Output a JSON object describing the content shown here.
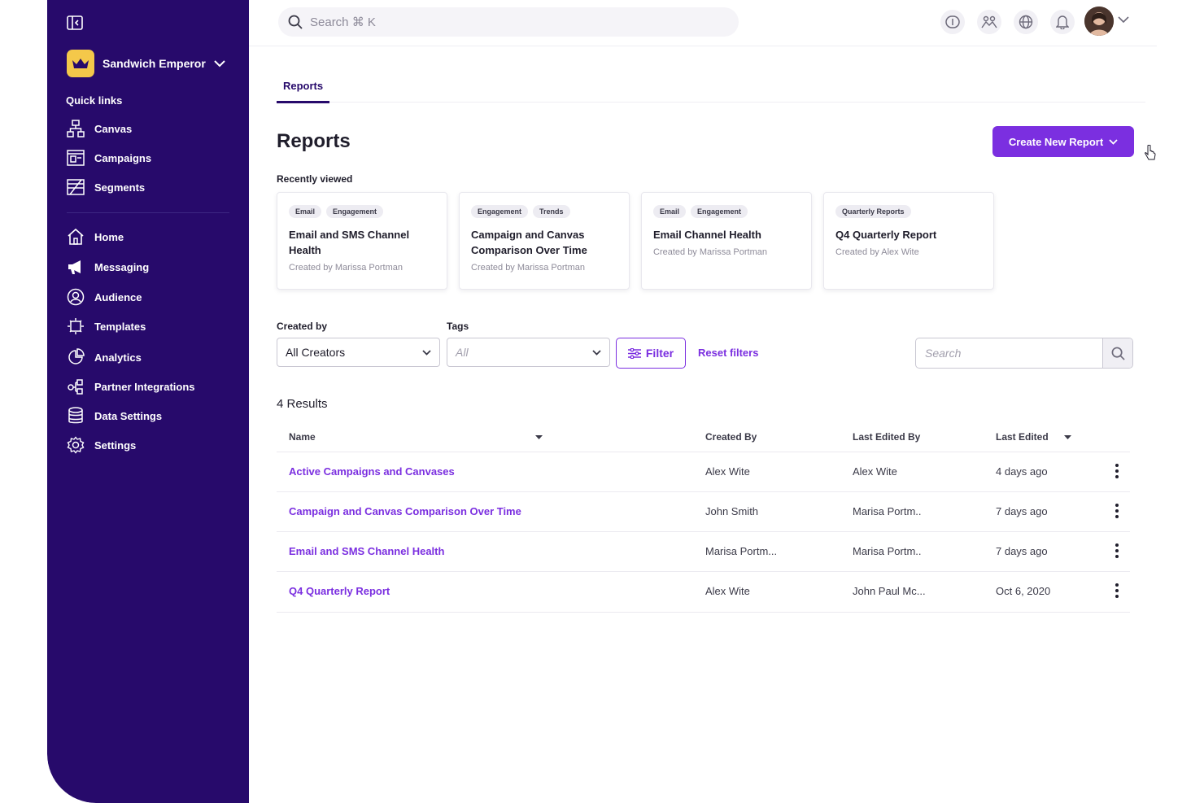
{
  "search": {
    "placeholder": "Search ⌘ K"
  },
  "sidebar": {
    "org_name": "Sandwich Emperor",
    "quick_links_title": "Quick links",
    "quick_links": [
      {
        "label": "Canvas",
        "icon": "canvas-icon"
      },
      {
        "label": "Campaigns",
        "icon": "campaigns-icon"
      },
      {
        "label": "Segments",
        "icon": "segments-icon"
      }
    ],
    "items": [
      {
        "label": "Home",
        "icon": "home-icon"
      },
      {
        "label": "Messaging",
        "icon": "megaphone-icon"
      },
      {
        "label": "Audience",
        "icon": "audience-icon"
      },
      {
        "label": "Templates",
        "icon": "templates-icon"
      },
      {
        "label": "Analytics",
        "icon": "analytics-icon"
      },
      {
        "label": "Partner Integrations",
        "icon": "integrations-icon"
      },
      {
        "label": "Data Settings",
        "icon": "database-icon"
      },
      {
        "label": "Settings",
        "icon": "gear-icon"
      }
    ]
  },
  "main": {
    "tab": "Reports",
    "title": "Reports",
    "create_button": "Create New Report",
    "recently_viewed_label": "Recently viewed",
    "recent": [
      {
        "tags": [
          "Email",
          "Engagement"
        ],
        "title": "Email and SMS Channel Health",
        "meta": "Created by Marissa Portman"
      },
      {
        "tags": [
          "Engagement",
          "Trends"
        ],
        "title": "Campaign and Canvas Comparison Over Time",
        "meta": "Created by Marissa Portman"
      },
      {
        "tags": [
          "Email",
          "Engagement"
        ],
        "title": "Email Channel Health",
        "meta": "Created by Marissa Portman"
      },
      {
        "tags": [
          "Quarterly Reports"
        ],
        "title": "Q4 Quarterly Report",
        "meta": "Created by Alex Wite"
      }
    ],
    "filters": {
      "created_by_label": "Created by",
      "created_by_value": "All Creators",
      "tags_label": "Tags",
      "tags_value": "All",
      "filter_button": "Filter",
      "reset_button": "Reset filters",
      "search_placeholder": "Search"
    },
    "results_count": "4 Results",
    "columns": [
      "Name",
      "Created By",
      "Last Edited By",
      "Last Edited"
    ],
    "rows": [
      {
        "name": "Active Campaigns and Canvases",
        "created_by": "Alex Wite",
        "last_edited_by": "Alex Wite",
        "last_edited": "4 days ago"
      },
      {
        "name": "Campaign and Canvas Comparison Over Time",
        "created_by": "John Smith",
        "last_edited_by": "Marisa Portm..",
        "last_edited": "7 days ago"
      },
      {
        "name": "Email and SMS Channel Health",
        "created_by": "Marisa Portm...",
        "last_edited_by": "Marisa Portm..",
        "last_edited": "7 days ago"
      },
      {
        "name": "Q4 Quarterly Report",
        "created_by": "Alex Wite",
        "last_edited_by": "John Paul Mc...",
        "last_edited": "Oct 6, 2020"
      }
    ]
  },
  "colors": {
    "sidebar": "#270a6b",
    "accent": "#7b2fe0",
    "org_logo": "#f4c84a"
  }
}
